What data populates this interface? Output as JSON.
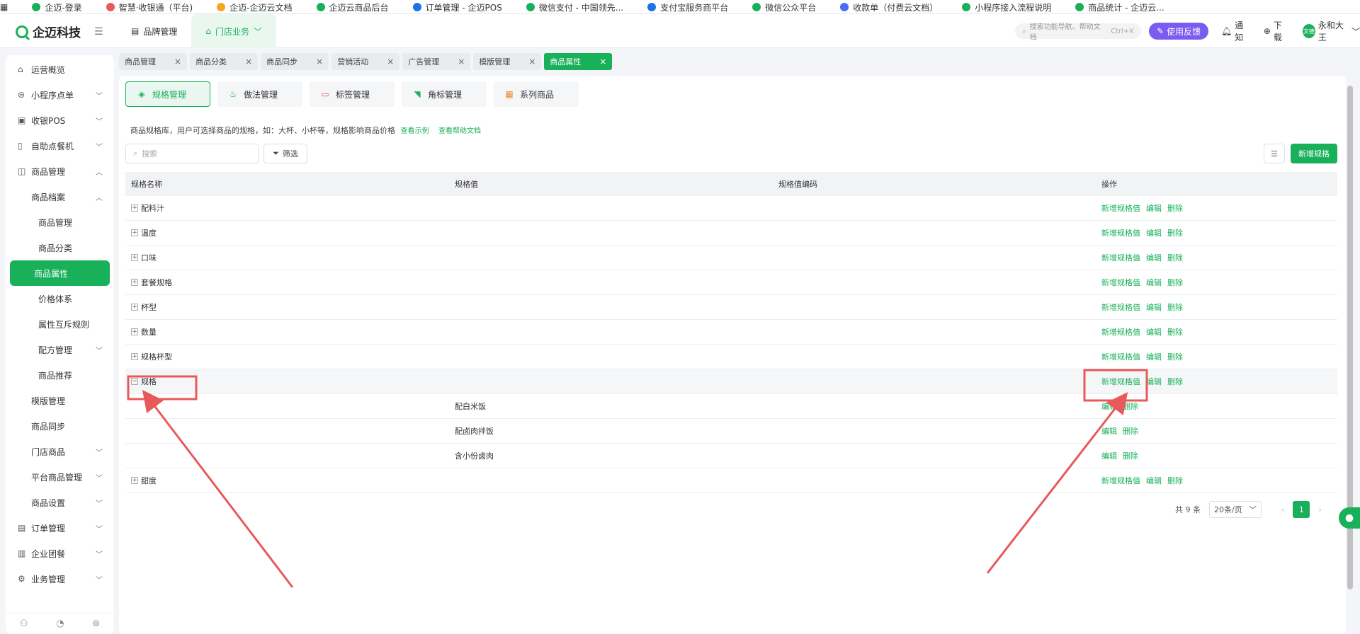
{
  "bookmarks": [
    "企迈-登录",
    "智慧·收银通（平台)",
    "企迈-企迈云文档",
    "企迈云商品后台",
    "订单管理 - 企迈POS",
    "微信支付 - 中国领先...",
    "支付宝服务商平台",
    "微信公众平台",
    "收款单（付费云文档）",
    "小程序接入流程说明",
    "商品统计 - 企迈云..."
  ],
  "brand": {
    "name": "企迈科技"
  },
  "top_nav": {
    "items": [
      {
        "label": "品牌管理"
      },
      {
        "label": "门店业务",
        "active": true
      }
    ]
  },
  "top_search": {
    "placeholder": "搜索功能导航、帮助文档",
    "shortcut": "Ctrl+K"
  },
  "header_actions": {
    "feedback": "使用反馈",
    "notify": "通知",
    "download": "下载",
    "user": "永和大王",
    "avatar_text": "文德"
  },
  "sidebar": {
    "items": [
      {
        "label": "运营概览",
        "icon": "home-icon",
        "level": 0
      },
      {
        "label": "小程序点单",
        "icon": "miniapp-icon",
        "level": 0,
        "chevron": "﹀"
      },
      {
        "label": "收银POS",
        "icon": "pos-icon",
        "level": 0,
        "chevron": "﹀"
      },
      {
        "label": "自助点餐机",
        "icon": "kiosk-icon",
        "level": 0,
        "chevron": "﹀"
      },
      {
        "label": "商品管理",
        "icon": "goods-icon",
        "level": 0,
        "chevron": "︿"
      },
      {
        "label": "商品档案",
        "level": 1,
        "chevron": "︿"
      },
      {
        "label": "商品管理",
        "level": 2
      },
      {
        "label": "商品分类",
        "level": 2
      },
      {
        "label": "商品属性",
        "level": 2,
        "active": true
      },
      {
        "label": "价格体系",
        "level": 2
      },
      {
        "label": "属性互斥规则",
        "level": 2
      },
      {
        "label": "配方管理",
        "level": 2,
        "chevron": "﹀"
      },
      {
        "label": "商品推荐",
        "level": 2
      },
      {
        "label": "模版管理",
        "level": 1
      },
      {
        "label": "商品同步",
        "level": 1
      },
      {
        "label": "门店商品",
        "level": 1,
        "chevron": "﹀"
      },
      {
        "label": "平台商品管理",
        "level": 1,
        "chevron": "﹀"
      },
      {
        "label": "商品设置",
        "level": 1,
        "chevron": "﹀"
      },
      {
        "label": "订单管理",
        "icon": "order-icon",
        "level": 0,
        "chevron": "﹀"
      },
      {
        "label": "企业团餐",
        "icon": "enterprise-icon",
        "level": 0,
        "chevron": "﹀"
      },
      {
        "label": "业务管理",
        "icon": "business-icon",
        "level": 0,
        "chevron": "﹀"
      }
    ]
  },
  "page_tabs": [
    {
      "label": "商品管理"
    },
    {
      "label": "商品分类"
    },
    {
      "label": "商品同步"
    },
    {
      "label": "营销活动"
    },
    {
      "label": "广告管理"
    },
    {
      "label": "模版管理"
    },
    {
      "label": "商品属性",
      "active": true
    }
  ],
  "sub_tabs": [
    {
      "label": "规格管理",
      "icon": "layers-icon",
      "active": true
    },
    {
      "label": "做法管理",
      "icon": "chef-hat-icon"
    },
    {
      "label": "标签管理",
      "icon": "tag-icon"
    },
    {
      "label": "角标管理",
      "icon": "corner-badge-icon"
    },
    {
      "label": "系列商品",
      "icon": "grid-icon"
    }
  ],
  "description": {
    "text": "商品规格库，用户可选择商品的规格，如：大杯、小杯等，规格影响商品价格",
    "link1": "查看示例",
    "link2": "查看帮助文档"
  },
  "toolbar": {
    "search_placeholder": "搜索",
    "filter": "筛选",
    "add": "新增规格"
  },
  "table": {
    "columns": [
      "规格名称",
      "规格值",
      "规格值编码",
      "操作"
    ],
    "rows": [
      {
        "name": "配料汁",
        "expander": "+",
        "actions": [
          "新增规格值",
          "编辑",
          "删除"
        ]
      },
      {
        "name": "温度",
        "expander": "+",
        "actions": [
          "新增规格值",
          "编辑",
          "删除"
        ]
      },
      {
        "name": "口味",
        "expander": "+",
        "actions": [
          "新增规格值",
          "编辑",
          "删除"
        ]
      },
      {
        "name": "套餐规格",
        "expander": "+",
        "actions": [
          "新增规格值",
          "编辑",
          "删除"
        ]
      },
      {
        "name": "杯型",
        "expander": "+",
        "actions": [
          "新增规格值",
          "编辑",
          "删除"
        ]
      },
      {
        "name": "数量",
        "expander": "+",
        "actions": [
          "新增规格值",
          "编辑",
          "删除"
        ]
      },
      {
        "name": "规格杯型",
        "expander": "+",
        "actions": [
          "新增规格值",
          "编辑",
          "删除"
        ]
      },
      {
        "name": "规格",
        "expander": "−",
        "highlight": true,
        "actions": [
          "新增规格值",
          "编辑",
          "删除"
        ]
      },
      {
        "value": "配白米饭",
        "child": true,
        "actions": [
          "编辑",
          "删除"
        ]
      },
      {
        "value": "配卤肉拌饭",
        "child": true,
        "actions": [
          "编辑",
          "删除"
        ]
      },
      {
        "value": "含小份卤肉",
        "child": true,
        "actions": [
          "编辑",
          "删除"
        ]
      },
      {
        "name": "甜度",
        "expander": "+",
        "actions": [
          "新增规格值",
          "编辑",
          "删除"
        ]
      }
    ]
  },
  "pagination": {
    "total": "共 9 条",
    "page_size": "20条/页",
    "current": "1"
  },
  "colors": {
    "accent": "#19b05a",
    "annotation": "#e85a5a",
    "feedback": "#7a5cf0"
  }
}
